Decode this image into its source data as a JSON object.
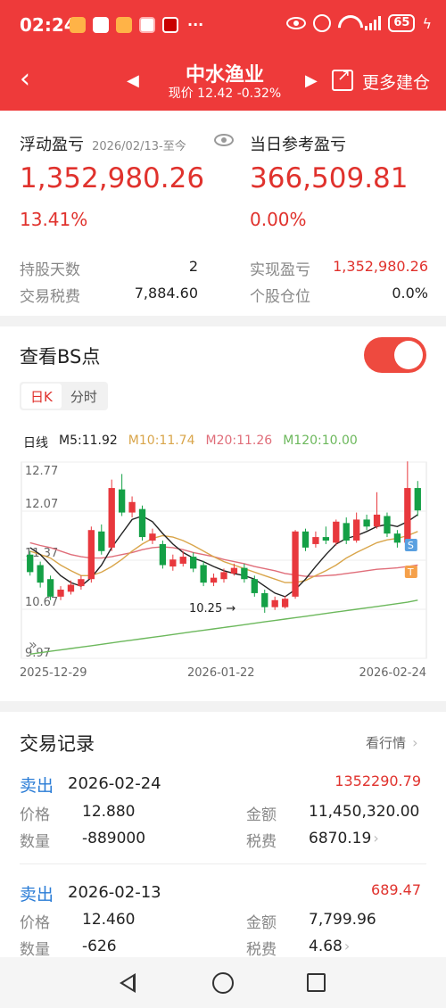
{
  "status_bar": {
    "time": "02:24",
    "notif_more": "···",
    "battery": "65"
  },
  "header": {
    "back_icon": "chevron-left-icon",
    "stock_name": "中水渔业",
    "price_line": "现价 12.42 -0.32%",
    "more_label": "更多建仓"
  },
  "summary": {
    "floating_label": "浮动盈亏",
    "date_range": "2026/02/13-至今",
    "floating_value": "1,352,980.26",
    "floating_pct": "13.41%",
    "today_label": "当日参考盈亏",
    "today_value": "366,509.81",
    "today_pct": "0.00%",
    "hold_days_label": "持股天数",
    "hold_days": "2",
    "tax_label": "交易税费",
    "tax": "7,884.60",
    "realized_label": "实现盈亏",
    "realized": "1,352,980.26",
    "position_label": "个股仓位",
    "position": "0.0%"
  },
  "bs_section": {
    "title": "查看BS点",
    "toggle_on": true,
    "tab_k": "日K",
    "tab_time": "分时",
    "line_label": "日线",
    "ma5": "M5:11.92",
    "ma10": "M10:11.74",
    "ma20": "M20:11.26",
    "ma120": "M120:10.00",
    "colors": {
      "ma5": "#222222",
      "ma10": "#d9a54a",
      "ma20": "#e06e7a",
      "ma120": "#6cb85c",
      "up": "#e8383d",
      "down": "#14a046"
    }
  },
  "chart_data": {
    "type": "candlestick",
    "ylim": [
      9.97,
      12.77
    ],
    "yticks": [
      "12.77",
      "12.07",
      "11.37",
      "10.67",
      "9.97"
    ],
    "xticks": [
      "2025-12-29",
      "2026-01-22",
      "2026-02-24"
    ],
    "low_annotation": "10.25 →",
    "markers": [
      {
        "label": "S",
        "index": 37
      },
      {
        "label": "T",
        "index": 37
      }
    ],
    "candles": [
      [
        11.45,
        11.2,
        11.5,
        11.15
      ],
      [
        11.3,
        11.05,
        11.35,
        10.98
      ],
      [
        11.1,
        10.85,
        11.15,
        10.8
      ],
      [
        10.85,
        10.95,
        11.0,
        10.8
      ],
      [
        10.92,
        11.02,
        11.08,
        10.88
      ],
      [
        11.0,
        11.1,
        11.15,
        10.95
      ],
      [
        11.1,
        11.8,
        11.85,
        11.05
      ],
      [
        11.78,
        11.5,
        11.88,
        11.45
      ],
      [
        11.55,
        12.4,
        12.52,
        11.5
      ],
      [
        12.38,
        12.05,
        12.6,
        12.0
      ],
      [
        12.05,
        12.2,
        12.28,
        11.98
      ],
      [
        12.1,
        11.7,
        12.15,
        11.65
      ],
      [
        11.65,
        11.75,
        11.82,
        11.6
      ],
      [
        11.6,
        11.3,
        11.65,
        11.25
      ],
      [
        11.28,
        11.38,
        11.45,
        11.22
      ],
      [
        11.32,
        11.42,
        11.5,
        11.28
      ],
      [
        11.42,
        11.25,
        11.48,
        11.2
      ],
      [
        11.3,
        11.05,
        11.36,
        11.0
      ],
      [
        11.05,
        11.12,
        11.18,
        11.0
      ],
      [
        11.1,
        11.2,
        11.25,
        11.05
      ],
      [
        11.18,
        11.26,
        11.32,
        11.15
      ],
      [
        11.26,
        11.1,
        11.32,
        11.05
      ],
      [
        11.1,
        10.9,
        11.15,
        10.85
      ],
      [
        10.9,
        10.7,
        10.95,
        10.62
      ],
      [
        10.7,
        10.8,
        10.85,
        10.66
      ],
      [
        10.7,
        10.82,
        10.86,
        10.68
      ],
      [
        10.85,
        11.78,
        11.8,
        10.82
      ],
      [
        11.78,
        11.55,
        11.82,
        11.5
      ],
      [
        11.6,
        11.7,
        11.78,
        11.55
      ],
      [
        11.7,
        11.65,
        11.85,
        11.6
      ],
      [
        11.62,
        11.92,
        11.95,
        11.58
      ],
      [
        11.9,
        11.65,
        11.98,
        11.6
      ],
      [
        11.65,
        11.95,
        12.05,
        11.62
      ],
      [
        11.95,
        11.85,
        12.02,
        11.8
      ],
      [
        11.85,
        12.02,
        12.34,
        11.82
      ],
      [
        12.0,
        11.75,
        12.05,
        11.7
      ],
      [
        11.75,
        11.62,
        11.8,
        11.55
      ],
      [
        11.62,
        12.4,
        12.78,
        11.6
      ],
      [
        12.4,
        12.08,
        12.5,
        12.0
      ]
    ],
    "ma5": [
      11.55,
      11.45,
      11.3,
      11.15,
      11.05,
      11.0,
      11.12,
      11.3,
      11.55,
      11.75,
      11.95,
      12.0,
      11.92,
      11.75,
      11.6,
      11.48,
      11.4,
      11.35,
      11.28,
      11.22,
      11.18,
      11.15,
      11.1,
      11.0,
      10.9,
      10.85,
      10.95,
      11.1,
      11.28,
      11.45,
      11.6,
      11.68,
      11.72,
      11.78,
      11.85,
      11.88,
      11.85,
      11.92,
      12.02
    ],
    "ma10": [
      11.5,
      11.45,
      11.4,
      11.3,
      11.22,
      11.15,
      11.15,
      11.2,
      11.28,
      11.38,
      11.5,
      11.6,
      11.68,
      11.72,
      11.7,
      11.65,
      11.58,
      11.5,
      11.42,
      11.35,
      11.3,
      11.25,
      11.2,
      11.15,
      11.1,
      11.05,
      11.05,
      11.08,
      11.15,
      11.22,
      11.3,
      11.4,
      11.48,
      11.55,
      11.62,
      11.66,
      11.68,
      11.72,
      11.78
    ],
    "ma20": [
      11.62,
      11.58,
      11.55,
      11.5,
      11.45,
      11.42,
      11.4,
      11.4,
      11.42,
      11.45,
      11.48,
      11.52,
      11.55,
      11.56,
      11.55,
      11.52,
      11.48,
      11.45,
      11.42,
      11.38,
      11.35,
      11.32,
      11.28,
      11.25,
      11.22,
      11.18,
      11.16,
      11.14,
      11.14,
      11.15,
      11.16,
      11.18,
      11.2,
      11.22,
      11.24,
      11.25,
      11.26,
      11.28,
      11.3
    ],
    "ma120": [
      10.03,
      10.05,
      10.07,
      10.09,
      10.11,
      10.13,
      10.15,
      10.17,
      10.19,
      10.21,
      10.23,
      10.25,
      10.27,
      10.29,
      10.31,
      10.33,
      10.35,
      10.37,
      10.39,
      10.41,
      10.43,
      10.45,
      10.47,
      10.49,
      10.51,
      10.53,
      10.55,
      10.57,
      10.59,
      10.61,
      10.63,
      10.65,
      10.67,
      10.69,
      10.71,
      10.73,
      10.75,
      10.77,
      10.8
    ]
  },
  "trades": {
    "title": "交易记录",
    "more": "看行情",
    "records": [
      {
        "type": "卖出",
        "date": "2026-02-24",
        "amount": "1352290.79",
        "price_label": "价格",
        "price": "12.880",
        "total_label": "金额",
        "total": "11,450,320.00",
        "qty_label": "数量",
        "qty": "-889000",
        "tax_label": "税费",
        "tax": "6870.19"
      },
      {
        "type": "卖出",
        "date": "2026-02-13",
        "amount": "689.47",
        "price_label": "价格",
        "price": "12.460",
        "total_label": "金额",
        "total": "7,799.96",
        "qty_label": "数量",
        "qty": "-626",
        "tax_label": "税费",
        "tax": "4.68"
      }
    ]
  }
}
